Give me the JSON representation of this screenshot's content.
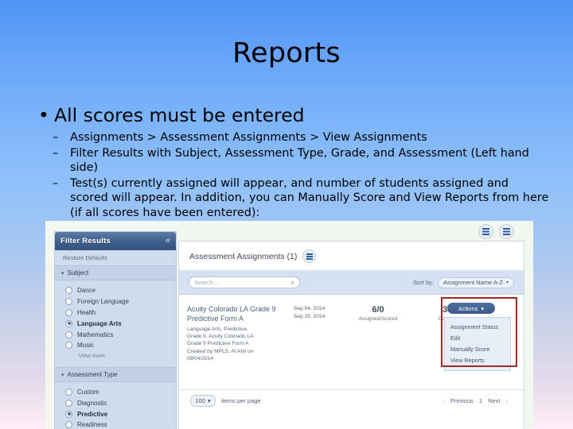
{
  "slide": {
    "title": "Reports",
    "bullet": "All scores must be entered",
    "sub_bullets": [
      "Assignments > Assessment Assignments > View Assignments",
      "Filter Results with Subject, Assessment Type, Grade, and Assessment (Left hand side)",
      "Test(s) currently assigned will appear, and number of students assigned and scored will appear. In addition, you can Manually Score and View Reports from here (if all scores have been entered):"
    ]
  },
  "screenshot": {
    "sidebar": {
      "header_title": "Filter Results",
      "collapse_icon": "«",
      "restore_label": "Restore Defaults",
      "groups": [
        {
          "label": "Subject",
          "caret": "▾",
          "options": [
            {
              "label": "Dance",
              "selected": false
            },
            {
              "label": "Foreign Language",
              "selected": false
            },
            {
              "label": "Health",
              "selected": false
            },
            {
              "label": "Language Arts",
              "selected": true
            },
            {
              "label": "Mathematics",
              "selected": false
            },
            {
              "label": "Music",
              "selected": false
            }
          ],
          "more_label": "View more"
        },
        {
          "label": "Assessment Type",
          "caret": "▾",
          "options": [
            {
              "label": "Custom",
              "selected": false
            },
            {
              "label": "Diagnostic",
              "selected": false
            },
            {
              "label": "Predictive",
              "selected": true
            },
            {
              "label": "Readiness",
              "selected": false
            }
          ],
          "more_label": ""
        }
      ]
    },
    "main": {
      "panel_title": "Assessment Assignments (1)",
      "search_placeholder": "Search...",
      "search_value": "",
      "search_icon": "⌕",
      "sort_label": "Sort by:",
      "sort_value": "Assignment Name A-Z",
      "sort_caret": "▾",
      "row": {
        "name": "Acuity Colorado LA Grade 9 Predictive Form A",
        "meta_lines": [
          "Language Arts, Predictive,",
          "Grade 9, Acuity Colorado LA",
          "Grade 9 Predictive Form A",
          "Created by MPLS, AI ANI on",
          "09/04/2014"
        ],
        "date_start": "Sep 04, 2014",
        "date_end": "Sep 25, 2014",
        "assigned_scored_value": "6/0",
        "assigned_scored_label": "Assigned/Scored",
        "completion_value": "33%",
        "completion_label": "Completion"
      },
      "actions": {
        "button_label": "Actions",
        "button_caret": "▾",
        "items": [
          "Assignment Status",
          "Edit",
          "Manually Score",
          "View Reports"
        ]
      },
      "footer": {
        "per_page_value": "100",
        "per_page_caret": "▾",
        "per_page_label": "items per page",
        "prev_arrow": "‹",
        "prev_label": "Previous",
        "page_number": "1",
        "next_label": "Next",
        "next_arrow": "›"
      }
    },
    "highlight_color": "#9e2a23"
  }
}
